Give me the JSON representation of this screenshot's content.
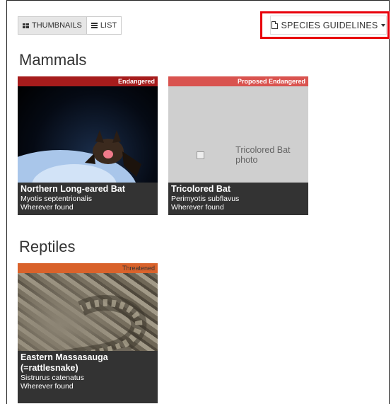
{
  "view_toggle": {
    "thumbnails_label": "THUMBNAILS",
    "list_label": "LIST"
  },
  "guidelines": {
    "label": "SPECIES GUIDELINES"
  },
  "sections": [
    {
      "title": "Mammals",
      "cards": [
        {
          "status": "Endangered",
          "status_color": "#a61c1c",
          "name": "Northern Long-eared Bat",
          "scientific": "Myotis septentrionalis",
          "range": "Wherever found"
        },
        {
          "status": "Proposed Endangered",
          "status_color": "#d9534f",
          "name": "Tricolored Bat",
          "scientific": "Perimyotis subflavus",
          "range": "Wherever found",
          "photo_alt": "Tricolored Bat photo"
        }
      ]
    },
    {
      "title": "Reptiles",
      "cards": [
        {
          "status": "Threatened",
          "status_color": "#d9622b",
          "name": "Eastern Massasauga (=rattlesnake)",
          "scientific": "Sistrurus catenatus",
          "range": "Wherever found"
        }
      ]
    }
  ]
}
